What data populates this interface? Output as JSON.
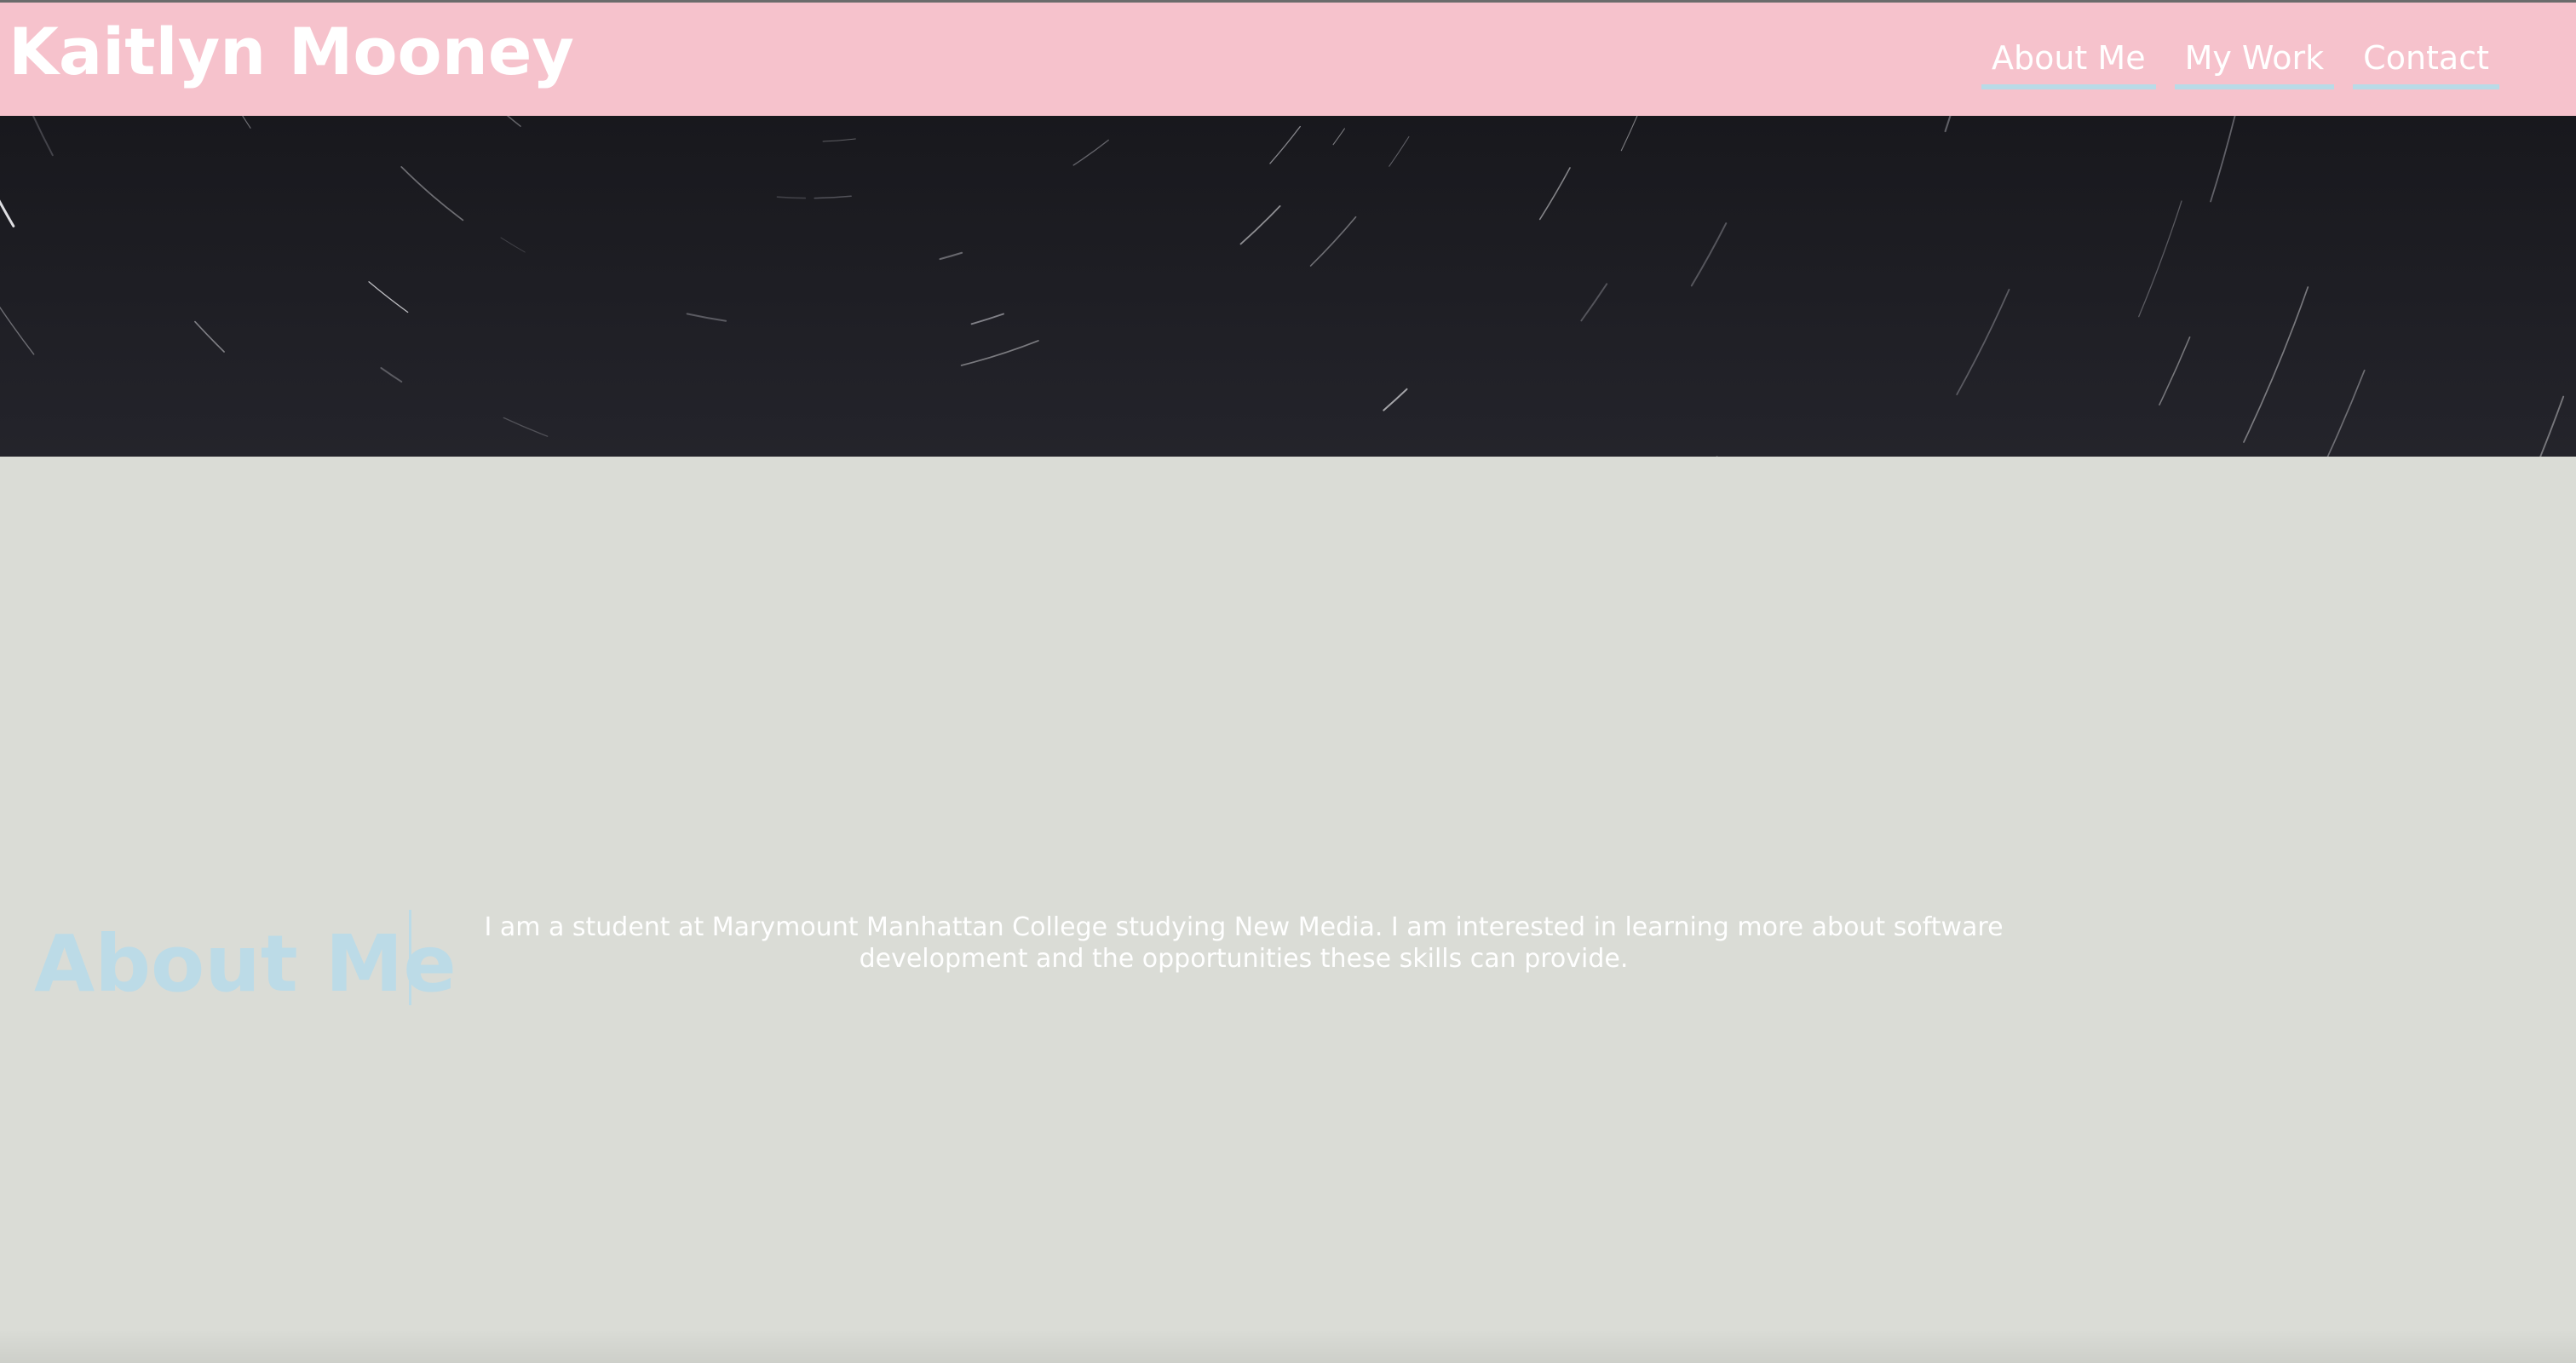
{
  "header": {
    "title": "Kaitlyn Mooney",
    "nav": [
      {
        "label": "About Me"
      },
      {
        "label": "My Work"
      },
      {
        "label": "Contact"
      }
    ]
  },
  "hero": {
    "image": "star-trails-night-sky"
  },
  "about": {
    "heading": "About Me",
    "text": "I am a student at Marymount Manhattan College studying New Media. I am interested in learning more about software development and the opportunities these skills can provide."
  },
  "colors": {
    "header_bg": "#f6c2cc",
    "page_bg": "#dadcd6",
    "accent_blue": "#bcdbe7",
    "hero_bg": "#1d1d23"
  }
}
